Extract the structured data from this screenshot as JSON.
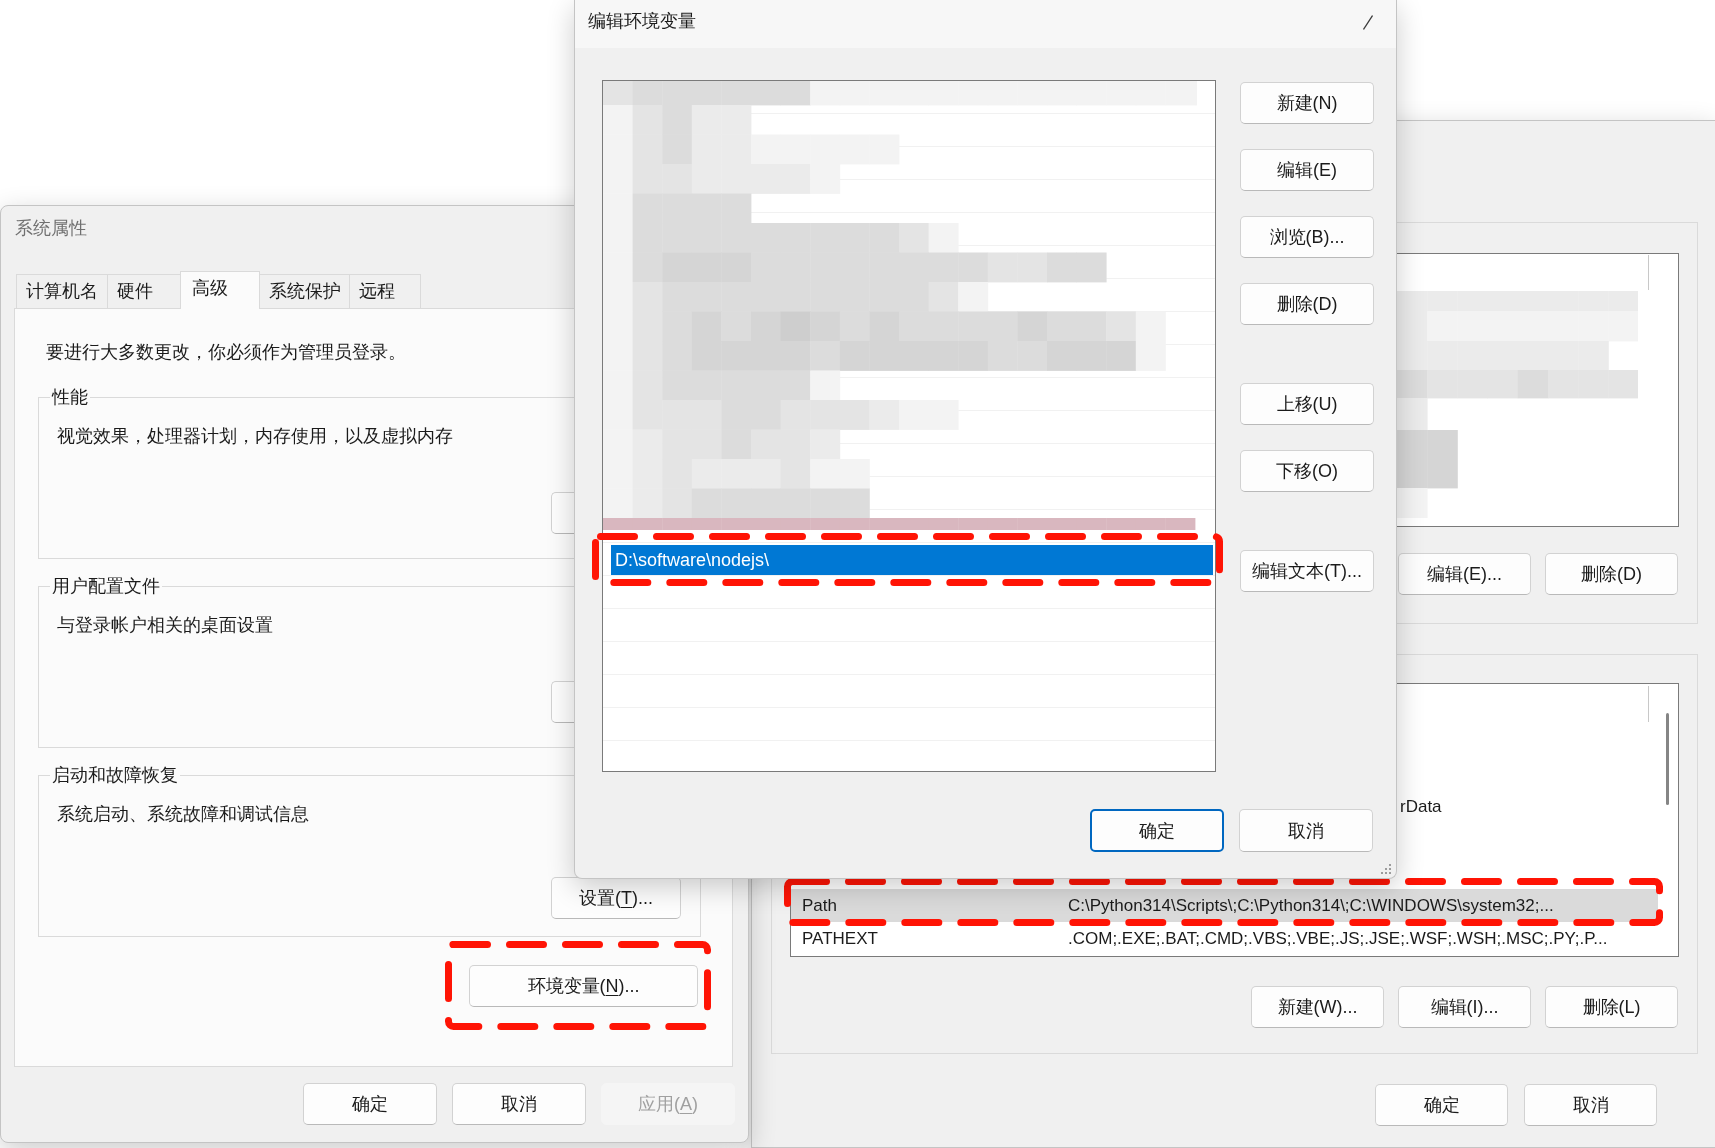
{
  "system_properties": {
    "title": "系统属性",
    "tabs": [
      {
        "label": "计算机名",
        "selected": false
      },
      {
        "label": "硬件",
        "selected": false
      },
      {
        "label": "高级",
        "selected": true
      },
      {
        "label": "系统保护",
        "selected": false
      },
      {
        "label": "远程",
        "selected": false
      }
    ],
    "notice": "要进行大多数更改，你必须作为管理员登录。",
    "groups": [
      {
        "title": "性能",
        "description": "视觉效果，处理器计划，内存使用，以及虚拟内存"
      },
      {
        "title": "用户配置文件",
        "description": "与登录帐户相关的桌面设置"
      },
      {
        "title": "启动和故障恢复",
        "description": "系统启动、系统故障和调试信息",
        "button": {
          "label": "设置(T)...",
          "mnemonic": true
        }
      }
    ],
    "environment_button": {
      "label": "环境变量(N)...",
      "mnemonic": true,
      "annotated": true
    },
    "buttons": [
      {
        "label": "确定",
        "disabled": false
      },
      {
        "label": "取消",
        "disabled": false
      },
      {
        "label": "应用(A)",
        "mnemonic": true,
        "disabled": true
      }
    ]
  },
  "edit_environment_variable": {
    "title": "编辑环境变量",
    "entries": [
      {
        "text": "D:\\software\\nodejs\\",
        "selected": true,
        "annotated": true
      }
    ],
    "side_buttons": [
      [
        "新建(N)",
        "编辑(E)",
        "浏览(B)...",
        "删除(D)"
      ],
      [
        "上移(U)",
        "下移(O)"
      ],
      [
        "编辑文本(T)..."
      ]
    ],
    "buttons": [
      {
        "label": "确定",
        "default": true
      },
      {
        "label": "取消",
        "default": false
      }
    ]
  },
  "environment_variables": {
    "user_variables": {
      "buttons": [
        "编辑(E)...",
        "删除(D)"
      ]
    },
    "system_variables": {
      "rows": [
        {
          "kind": "partial",
          "value": "rData",
          "selected": false,
          "annotated": false
        },
        {
          "kind": "variable",
          "name": "Path",
          "value": "C:\\Python314\\Scripts\\;C:\\Python314\\;C:\\WINDOWS\\system32;...",
          "selected": true,
          "annotated": true
        },
        {
          "kind": "variable",
          "name": "PATHEXT",
          "value": ".COM;.EXE;.BAT;.CMD;.VBS;.VBE;.JS;.JSE;.WSF;.WSH;.MSC;.PY;.P...",
          "selected": false,
          "annotated": false
        }
      ],
      "buttons": [
        "新建(W)...",
        "编辑(I)...",
        "删除(L)"
      ]
    },
    "buttons": [
      "确定",
      "取消"
    ]
  }
}
